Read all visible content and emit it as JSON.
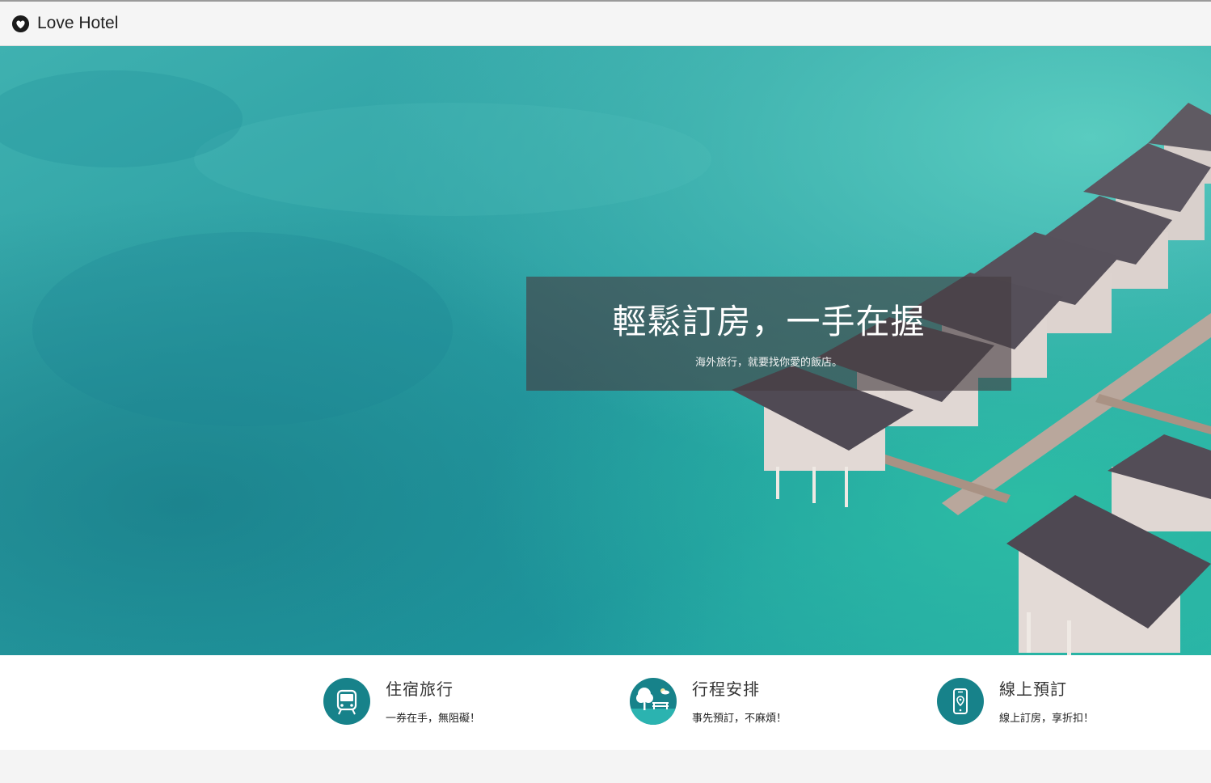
{
  "navbar": {
    "brand_name": "Love Hotel",
    "brand_icon": "heart-circle-icon"
  },
  "hero": {
    "title": "輕鬆訂房，一手在握",
    "subtitle": "海外旅行，就要找你愛的飯店。",
    "background": "aerial-turquoise-ocean-overwater-villas"
  },
  "features": [
    {
      "icon": "bus-icon",
      "title": "住宿旅行",
      "desc": "一券在手，無阻礙！"
    },
    {
      "icon": "park-bench-tree-icon",
      "title": "行程安排",
      "desc": "事先預訂，不麻煩！"
    },
    {
      "icon": "smartphone-location-icon",
      "title": "線上預訂",
      "desc": "線上訂房，享折扣！"
    }
  ],
  "colors": {
    "accent": "#17828a",
    "navbar_bg": "#f5f5f5",
    "ocean": "#2aa3a4"
  }
}
